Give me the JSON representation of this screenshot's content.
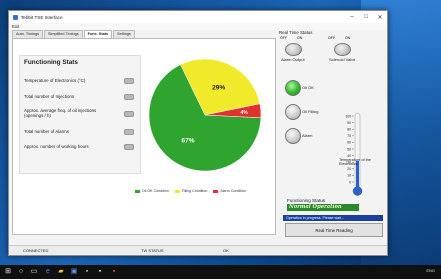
{
  "window": {
    "title": "Tebbit TSE Interface",
    "menu": "Exit"
  },
  "tabs": [
    "Auto. Timings",
    "Simplified Timings",
    "Func. Stats",
    "Settings"
  ],
  "stats": {
    "title": "Functioning Stats",
    "rows": [
      "Temperature of Electronics (°C)",
      "Total number of Injections",
      "Approx. average freq. of oil injections (openings / h)",
      "Total number of Alarms",
      "Approx. number of working hours"
    ]
  },
  "chart_data": {
    "type": "pie",
    "labels": [
      "Oil OK Condition",
      "Filling Condition",
      "Alarm Condition"
    ],
    "values": [
      67,
      29,
      4
    ],
    "value_labels": [
      "67%",
      "29%",
      "4%"
    ],
    "colors": [
      "#2fa52f",
      "#f0ea2a",
      "#e0322c"
    ]
  },
  "right": {
    "realtime_label": "Real Time Status",
    "off": "OFF",
    "on": "ON",
    "alarm_output": "Alarm Output",
    "solenoid_valve": "Solenoid Valve",
    "oil_ok": "Oil OK",
    "oil_filling": "Oil Filling",
    "alarm": "Alarm",
    "thermo_ticks": [
      "100",
      "90",
      "80",
      "70",
      "60",
      "50",
      "40",
      "30",
      "20",
      "10",
      "0"
    ],
    "thermo_value": 32,
    "thermo_label": "Temperature of the Electronics",
    "status_title": "Functioning Status",
    "status_value": "Normal Operation",
    "progress_text": "Operation in progress. Please wait...",
    "button": "Real Time Reading"
  },
  "statusbar": {
    "connected": "CONNECTED",
    "tw_status": "TW STATUS",
    "ok": "OK"
  },
  "tray": {
    "lang": "ENG"
  }
}
